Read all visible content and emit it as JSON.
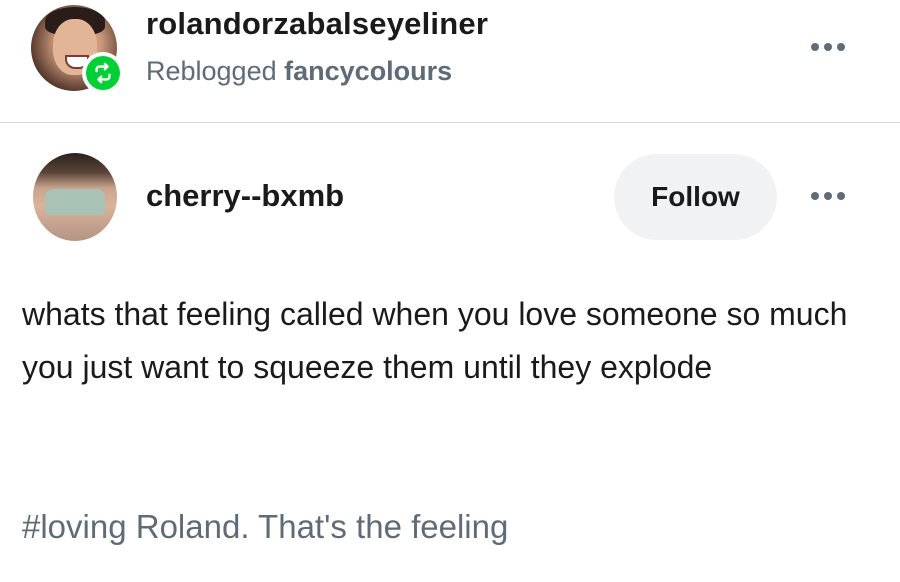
{
  "reblog": {
    "username": "rolandorzabalseyeliner",
    "reblogged_prefix": "Reblogged",
    "source": "fancycolours"
  },
  "post": {
    "author": "cherry--bxmb",
    "follow_label": "Follow",
    "body": "whats that feeling called when you love someone so much you just want to squeeze them until they explode",
    "tag": "#loving Roland. That's the feeling"
  },
  "icons": {
    "reblog_badge": "reblog-icon",
    "more": "more-options-icon"
  },
  "colors": {
    "reblog_green": "#00cf35",
    "follow_bg": "#f1f2f4",
    "muted_text": "#5f6b76"
  }
}
